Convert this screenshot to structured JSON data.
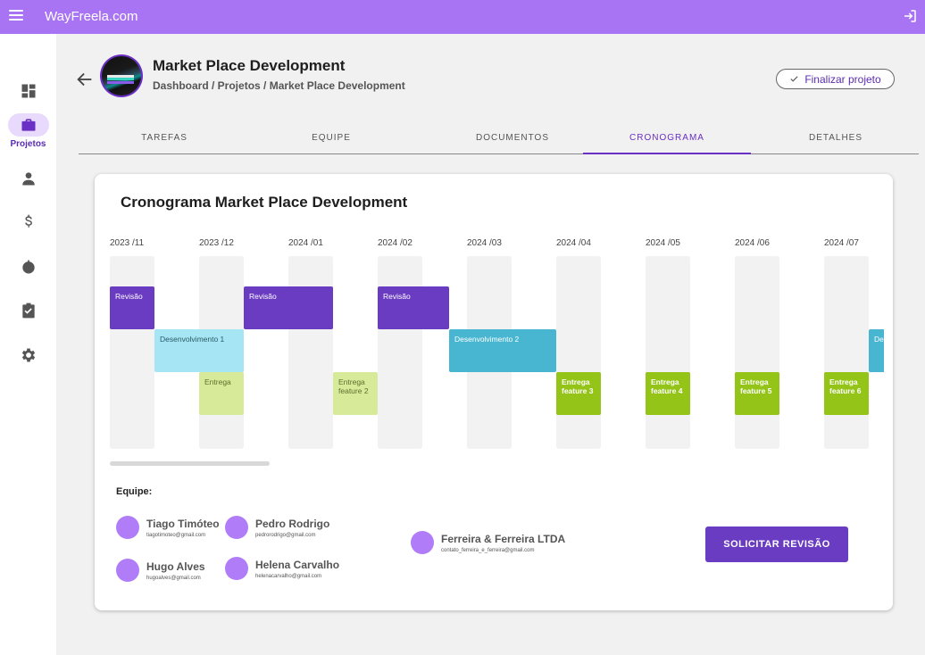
{
  "app": {
    "brand": "WayFreela.com"
  },
  "sidebar": {
    "items": [
      {
        "icon": "dashboard-icon",
        "label": ""
      },
      {
        "icon": "briefcase-icon",
        "label": "Projetos",
        "active": true
      },
      {
        "icon": "person-icon",
        "label": ""
      },
      {
        "icon": "dollar-icon",
        "label": ""
      },
      {
        "icon": "timer-icon",
        "label": ""
      },
      {
        "icon": "clipboard-check-icon",
        "label": ""
      },
      {
        "icon": "gear-icon",
        "label": ""
      }
    ]
  },
  "header": {
    "title": "Market Place Development",
    "breadcrumb": "Dashboard / Projetos / Market Place Development",
    "finalize_label": "Finalizar projeto"
  },
  "tabs": [
    "TAREFAS",
    "EQUIPE",
    "DOCUMENTOS",
    "CRONOGRAMA",
    "DETALHES"
  ],
  "active_tab": "CRONOGRAMA",
  "schedule": {
    "title": "Cronograma Market Place Development",
    "months": [
      "2023 /11",
      "2023 /12",
      "2024 /01",
      "2024 /02",
      "2024 /03",
      "2024 /04",
      "2024 /05",
      "2024 /06",
      "2024 /07"
    ],
    "bars": [
      {
        "label": "Revisão",
        "kind": "revisao"
      },
      {
        "label": "Revisão",
        "kind": "revisao"
      },
      {
        "label": "Revisão",
        "kind": "revisao"
      },
      {
        "label": "Desenvolvimento 1",
        "kind": "dev"
      },
      {
        "label": "Desenvolvimento 2",
        "kind": "dev2"
      },
      {
        "label": "De",
        "kind": "dev2"
      },
      {
        "label": "Entrega",
        "kind": "entrega"
      },
      {
        "label": "Entrega feature 2",
        "kind": "entrega"
      },
      {
        "label": "Entrega feature 3",
        "kind": "feature"
      },
      {
        "label": "Entrega feature 4",
        "kind": "feature"
      },
      {
        "label": "Entrega feature 5",
        "kind": "feature"
      },
      {
        "label": "Entrega feature 6",
        "kind": "feature"
      }
    ]
  },
  "team": {
    "label": "Equipe:",
    "members": [
      {
        "name": "Tiago Timóteo",
        "email": "tiagotimoteo@gmail.com"
      },
      {
        "name": "Pedro Rodrigo",
        "email": "pedrorodrigo@gmail.com"
      },
      {
        "name": "Ferreira & Ferreira LTDA",
        "email": "contato_ferreira_e_ferreira@gmail.com"
      },
      {
        "name": "Hugo Alves",
        "email": "hugoalves@gmail.com"
      },
      {
        "name": "Helena Carvalho",
        "email": "helenacarvalho@gmail.com"
      }
    ]
  },
  "cta_label": "SOLICITAR REVISÃO",
  "colors": {
    "accent": "#6a3cc2",
    "topbar": "#a874f4",
    "feature": "#93c417",
    "dev": "#a6e6f4",
    "dev2": "#48b6d0"
  }
}
